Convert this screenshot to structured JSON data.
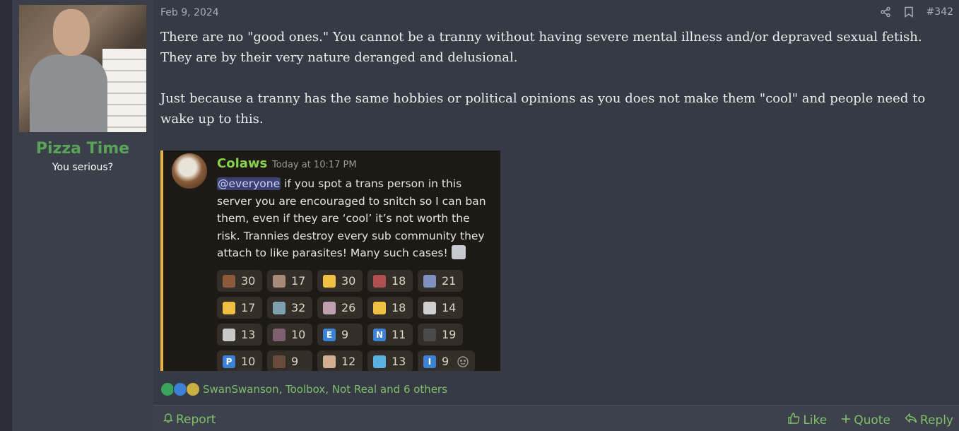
{
  "user": {
    "username": "Pizza Time",
    "title": "You serious?",
    "name_color": "#5aa35a"
  },
  "post": {
    "date": "Feb 9, 2024",
    "number": "#342",
    "paragraphs": [
      "There are no \"good ones.\" You cannot be a tranny without having severe mental illness and/or depraved sexual fetish. They are by their very nature deranged and delusional.",
      "Just because a tranny has the same hobbies or political opinions as you does not make them \"cool\" and people need to wake up to this."
    ]
  },
  "screenshot": {
    "author": "Colaws",
    "timestamp": "Today at 10:17 PM",
    "mention": "@everyone",
    "message": "if you spot a trans person in this server you are encouraged to snitch so I can ban them, even if they are ‘cool’ it’s not worth the risk. Trannies destroy every sub community they attach to like parasites! Many such cases!",
    "reactions": [
      {
        "count": "30",
        "icon": "face-emoji",
        "color": "#8b5a3c"
      },
      {
        "count": "17",
        "icon": "face-emoji",
        "color": "#a88a78"
      },
      {
        "count": "30",
        "icon": "point-up-emoji",
        "color": "#f0c040"
      },
      {
        "count": "18",
        "icon": "face-emoji",
        "color": "#b05050"
      },
      {
        "count": "21",
        "icon": "face-emoji",
        "color": "#8090c0"
      },
      {
        "count": "17",
        "icon": "finger-emoji",
        "color": "#f0c040"
      },
      {
        "count": "32",
        "icon": "eye-emoji",
        "color": "#7fa0b0"
      },
      {
        "count": "26",
        "icon": "face-emoji",
        "color": "#c0a0b0"
      },
      {
        "count": "18",
        "icon": "fist-emoji",
        "color": "#f0c040"
      },
      {
        "count": "14",
        "icon": "frame-emoji",
        "color": "#d0d0d0"
      },
      {
        "count": "13",
        "icon": "face-emoji",
        "color": "#c8c8c8"
      },
      {
        "count": "10",
        "icon": "face-emoji",
        "color": "#806070"
      },
      {
        "count": "9",
        "icon": "letter-e-emoji",
        "color": "#3b82d6",
        "letter": "E"
      },
      {
        "count": "11",
        "icon": "letter-n-emoji",
        "color": "#3b82d6",
        "letter": "N"
      },
      {
        "count": "19",
        "icon": "face-emoji",
        "color": "#4a4a4a"
      },
      {
        "count": "10",
        "icon": "letter-p-emoji",
        "color": "#3b82d6",
        "letter": "P"
      },
      {
        "count": "9",
        "icon": "bomb-emoji",
        "color": "#6a4a3a"
      },
      {
        "count": "12",
        "icon": "face-emoji",
        "color": "#d0b090"
      },
      {
        "count": "13",
        "icon": "gem-emoji",
        "color": "#5ab0e0"
      },
      {
        "count": "9",
        "icon": "letter-i-emoji",
        "color": "#3b82d6",
        "letter": "I"
      }
    ]
  },
  "reactions_summary": {
    "text": "SwanSwanson, Toolbox, Not Real and 6 others",
    "icons": [
      "check-icon",
      "thumbs-up-icon",
      "puzzle-icon"
    ]
  },
  "footer": {
    "report": "Report",
    "like": "Like",
    "quote": "Quote",
    "reply": "Reply"
  },
  "colors": {
    "accent": "#7fbf6a",
    "background": "#363a44"
  }
}
